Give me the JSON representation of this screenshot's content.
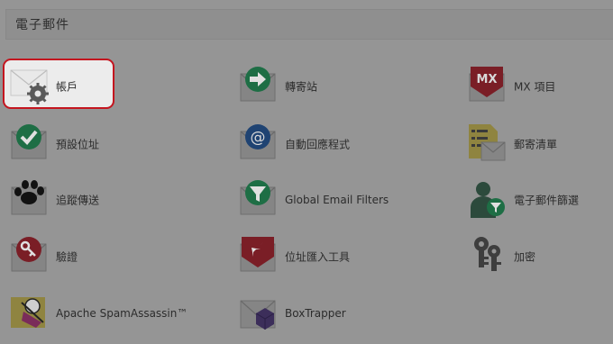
{
  "panel": {
    "title": "電子郵件"
  },
  "items": [
    {
      "label": "帳戶",
      "icon": "email-accounts-icon"
    },
    {
      "label": "轉寄站",
      "icon": "forwarders-icon"
    },
    {
      "label": "MX 項目",
      "icon": "mx-entry-icon",
      "badge": "MX"
    },
    {
      "label": "預設位址",
      "icon": "default-address-icon"
    },
    {
      "label": "自動回應程式",
      "icon": "autoresponders-icon",
      "badge": "@"
    },
    {
      "label": "郵寄清單",
      "icon": "mailing-lists-icon"
    },
    {
      "label": "追蹤傳送",
      "icon": "track-delivery-icon"
    },
    {
      "label": "Global Email Filters",
      "icon": "global-email-filters-icon"
    },
    {
      "label": "電子郵件篩選",
      "icon": "email-filters-icon"
    },
    {
      "label": "驗證",
      "icon": "authentication-icon"
    },
    {
      "label": "位址匯入工具",
      "icon": "address-importer-icon"
    },
    {
      "label": "加密",
      "icon": "encryption-icon"
    },
    {
      "label": "Apache SpamAssassin™",
      "icon": "spamassassin-icon"
    },
    {
      "label": "BoxTrapper",
      "icon": "boxtrapper-icon"
    }
  ],
  "colors": {
    "overlay_background": "#959595",
    "highlight_border": "#c4151f",
    "green": "#1e6e45",
    "blue": "#1f4372",
    "red": "#7a1e26"
  }
}
